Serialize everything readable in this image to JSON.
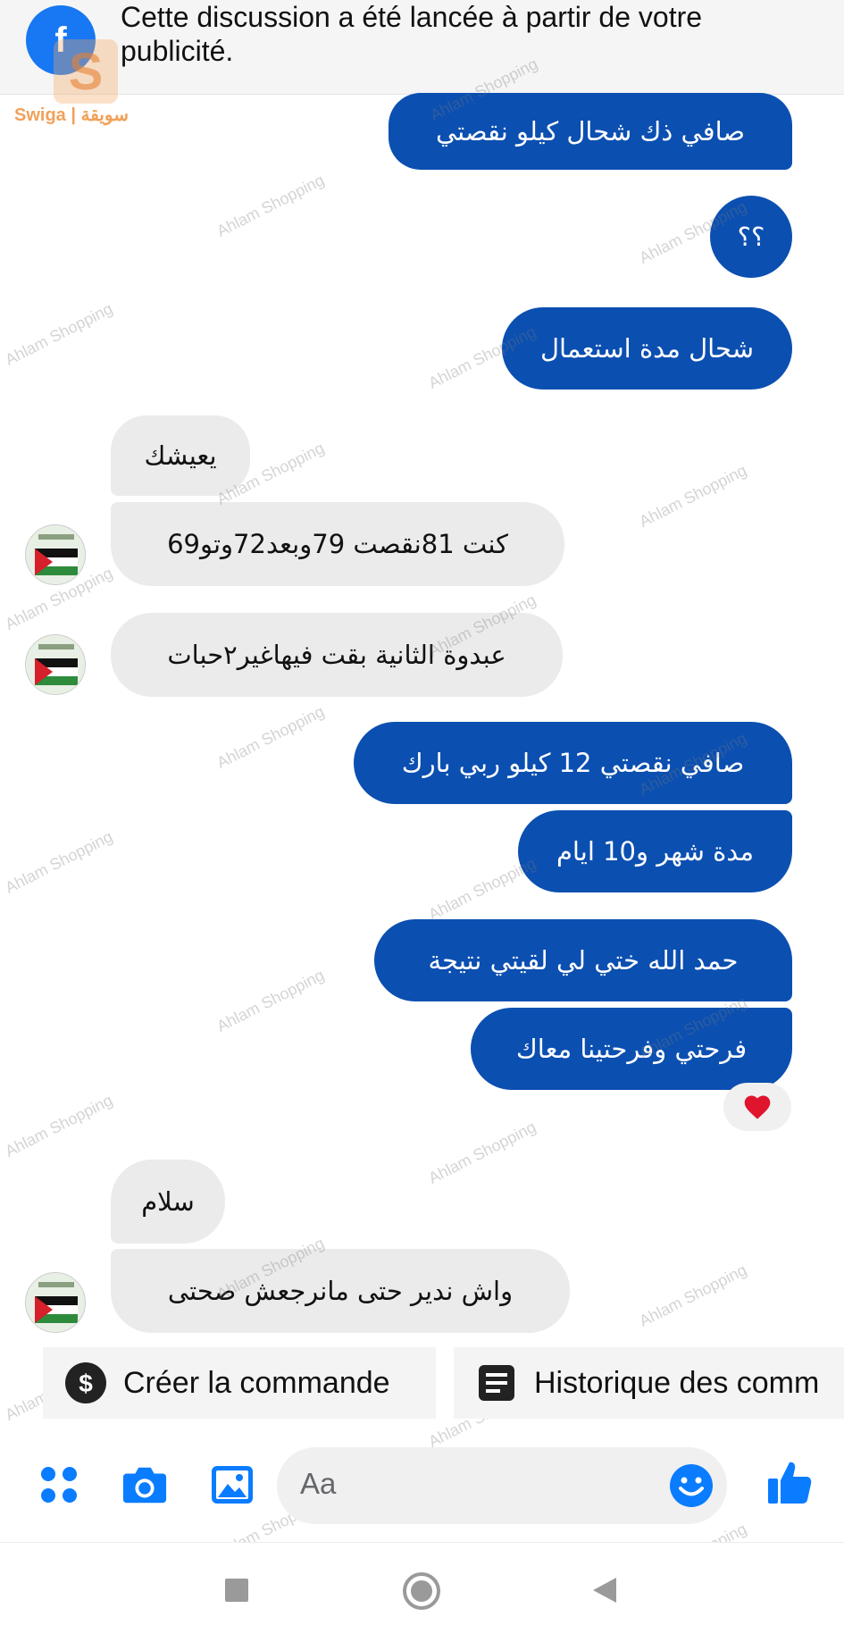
{
  "banner": {
    "text": "Cette discussion a été lancée à partir de votre publicité.",
    "icon": "messenger-ads-icon",
    "brand_logo_text": "Swiga | سويقة"
  },
  "watermark": "Ahlam Shopping",
  "messages": [
    {
      "side": "out",
      "text": "صافي ذك شحال كيلو نقصتي"
    },
    {
      "side": "out",
      "text": "؟؟"
    },
    {
      "side": "out",
      "text": "شحال مدة استعمال"
    },
    {
      "side": "in",
      "text": "يعيشك"
    },
    {
      "side": "in",
      "text": "كنت 81نقصت 79وبعد72وتو69"
    },
    {
      "side": "in",
      "text": "عبدوة الثانية بقت فيهاغير٢حبات"
    },
    {
      "side": "out",
      "text": "صافي نقصتي 12 كيلو ربي بارك"
    },
    {
      "side": "out",
      "text": "مدة شهر و10 ايام"
    },
    {
      "side": "out",
      "text": "حمد الله ختي لي لقيتي نتيجة"
    },
    {
      "side": "out",
      "text": "فرحتي وفرحتينا معاك"
    },
    {
      "side": "in",
      "text": "سلام"
    },
    {
      "side": "in",
      "text": "واش ندير حتى مانرجعش صحتى"
    }
  ],
  "reaction": {
    "emoji": "❤️",
    "icon": "heart-reaction-icon"
  },
  "quick_actions": [
    {
      "label": "Créer la commande",
      "icon": "dollar-icon"
    },
    {
      "label": "Historique des comm",
      "icon": "list-icon"
    }
  ],
  "composer": {
    "placeholder": "Aa",
    "icons": [
      "apps-icon",
      "camera-icon",
      "gallery-icon",
      "emoji-icon",
      "like-icon"
    ]
  },
  "colors": {
    "outgoing_bubble": "#0b4fb1",
    "incoming_bubble": "#ebebeb",
    "accent": "#0a7cff"
  }
}
